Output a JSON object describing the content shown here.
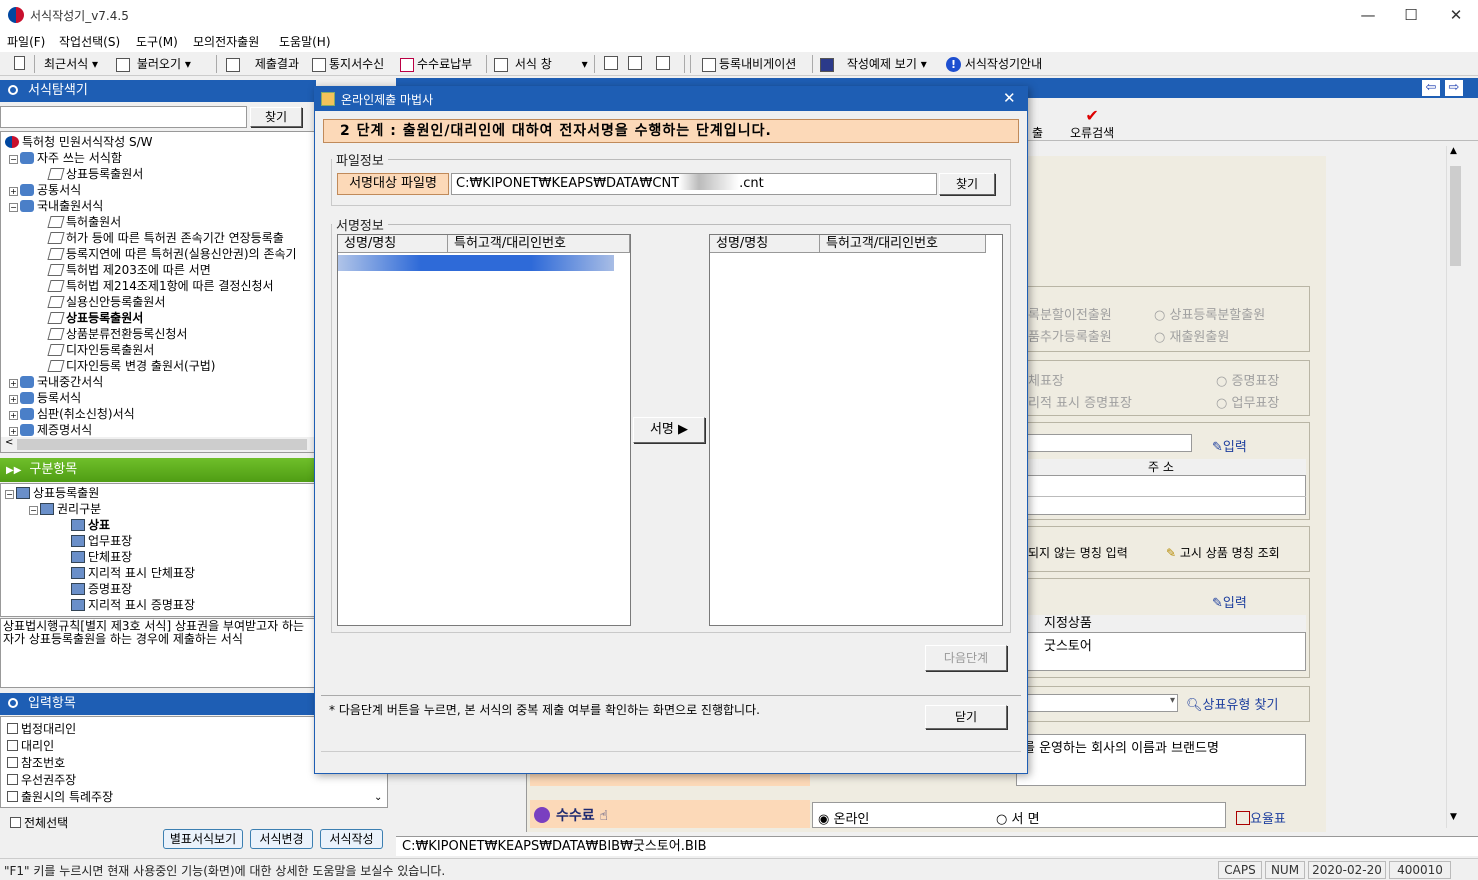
{
  "app": {
    "title": "서식작성기_v7.4.5"
  },
  "menu": [
    "파일(F)",
    "작업선택(S)",
    "도구(M)",
    "모의전자출원",
    "도움말(H)"
  ],
  "toolbar": {
    "recent": "최근서식",
    "load": "불러오기",
    "result": "제출결과",
    "notice": "통지서수신",
    "fee": "수수료납부",
    "window": "서식 창",
    "navigation": "등록내비게이션",
    "examples": "작성예제 보기",
    "guide": "서식작성기안내"
  },
  "explorer": {
    "title": "서식탐색기",
    "find": "찾기",
    "tree": [
      {
        "label": "특허청 민원서식작성 S/W",
        "level": 0,
        "icon": "logo"
      },
      {
        "label": "자주 쓰는 서식함",
        "level": 1,
        "exp": "−",
        "icon": "grp"
      },
      {
        "label": "상표등록출원서",
        "level": 2,
        "icon": "doc"
      },
      {
        "label": "공통서식",
        "level": 1,
        "exp": "+",
        "icon": "grp"
      },
      {
        "label": "국내출원서식",
        "level": 1,
        "exp": "−",
        "icon": "grp"
      },
      {
        "label": "특허출원서",
        "level": 2,
        "icon": "doc"
      },
      {
        "label": "허가 등에 따른 특허권 존속기간 연장등록출",
        "level": 2,
        "icon": "doc"
      },
      {
        "label": "등록지연에 따른 특허권(실용신안권)의 존속기",
        "level": 2,
        "icon": "doc"
      },
      {
        "label": "특허법 제203조에 따른 서면",
        "level": 2,
        "icon": "doc"
      },
      {
        "label": "특허법 제214조제1항에 따른 결정신청서",
        "level": 2,
        "icon": "doc"
      },
      {
        "label": "실용신안등록출원서",
        "level": 2,
        "icon": "doc"
      },
      {
        "label": "상표등록출원서",
        "level": 2,
        "icon": "doc",
        "bold": true
      },
      {
        "label": "상품분류전환등록신청서",
        "level": 2,
        "icon": "doc"
      },
      {
        "label": "디자인등록출원서",
        "level": 2,
        "icon": "doc"
      },
      {
        "label": "디자인등록 변경 출원서(구법)",
        "level": 2,
        "icon": "doc"
      },
      {
        "label": "국내중간서식",
        "level": 1,
        "exp": "+",
        "icon": "grp"
      },
      {
        "label": "등록서식",
        "level": 1,
        "exp": "+",
        "icon": "grp"
      },
      {
        "label": "심판(취소신청)서식",
        "level": 1,
        "exp": "+",
        "icon": "grp"
      },
      {
        "label": "제증명서식",
        "level": 1,
        "exp": "+",
        "icon": "grp"
      }
    ]
  },
  "category": {
    "title": "구분항목",
    "tree": [
      {
        "label": "상표등록출원",
        "level": 0,
        "exp": "−"
      },
      {
        "label": "권리구분",
        "level": 1,
        "exp": "−"
      },
      {
        "label": "상표",
        "level": 2,
        "bold": true
      },
      {
        "label": "업무표장",
        "level": 2
      },
      {
        "label": "단체표장",
        "level": 2
      },
      {
        "label": "지리적 표시 단체표장",
        "level": 2
      },
      {
        "label": "증명표장",
        "level": 2
      },
      {
        "label": "지리적 표시 증명표장",
        "level": 2
      }
    ],
    "description": "상표법시행규칙[별지 제3호 서식] 상표권을 부여받고자 하는 자가 상표등록출원을 하는 경우에 제출하는 서식"
  },
  "inputs": {
    "title": "입력항목",
    "items": [
      "법정대리인",
      "대리인",
      "참조번호",
      "우선권주장",
      "출원시의 특례주장"
    ],
    "select_all": "전체선택",
    "btn_special": "별표서식보기",
    "btn_change": "서식변경",
    "btn_write": "서식작성"
  },
  "right": {
    "error_check": "오류검색",
    "submit_frag": "출",
    "radio_row1": [
      "록분할이전출원",
      "상표등록분할출원"
    ],
    "radio_row2": [
      "품추가등록출원",
      "재출원출원"
    ],
    "radio_row3": [
      "체표장",
      "증명표장"
    ],
    "radio_row4": [
      "리적 표시 증명표장",
      "업무표장"
    ],
    "input_label": "입력",
    "addr_header": "주 소",
    "unlisted": "되지 않는 명칭 입력",
    "notice_lookup": "고시 상품 명칭 조회",
    "input_label2": "입력",
    "designated_header": "지정상품",
    "designated_value": "굿스토어",
    "type_find": "상표유형 찾기",
    "desc_text": "를 운영하는 회사의 이름과 브랜드명",
    "fee_label": "수수료",
    "online": "온라인",
    "paper": "서 면",
    "rate_table": "요율표"
  },
  "dialog": {
    "title": "온라인제출 마법사",
    "step": "2 단계 : 출원인/대리인에 대하여 전자서명을 수행하는 단계입니다.",
    "file_legend": "파일정보",
    "file_label": "서명대상 파일명",
    "file_path_start": "C:₩KIPONET₩KEAPS₩DATA₩CNT",
    "file_path_end": ".cnt",
    "find": "찾기",
    "sign_legend": "서명정보",
    "col_name": "성명/명칭",
    "col_code": "특허고객/대리인번호",
    "sign_btn": "서명 ▶",
    "next_btn": "다음단계",
    "note": "* 다음단계 버튼을 누르면, 본 서식의 중복 제출 여부를 확인하는 화면으로 진행합니다.",
    "close_btn": "닫기"
  },
  "path_bar": "C:₩KIPONET₩KEAPS₩DATA₩BIB₩굿스토어.BIB",
  "status": {
    "help": "\"F1\" 키를 누르시면 현재 사용중인 기능(화면)에 대한 상세한 도움말을 보실수 있습니다.",
    "caps": "CAPS",
    "num": "NUM",
    "date": "2020-02-20",
    "code": "400010"
  }
}
